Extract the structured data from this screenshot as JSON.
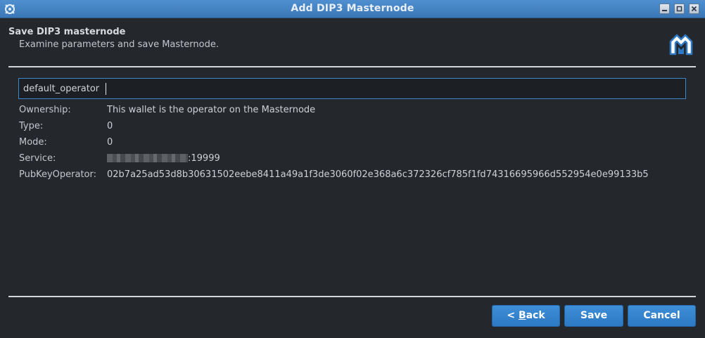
{
  "window": {
    "title": "Add DIP3 Masternode"
  },
  "header": {
    "title": "Save DIP3 masternode",
    "subtitle": "Examine parameters and save Masternode."
  },
  "form": {
    "name_value": "default_operator"
  },
  "details": {
    "ownership_label": "Ownership:",
    "ownership_value": "This wallet is the operator on the Masternode",
    "type_label": "Type:",
    "type_value": "0",
    "mode_label": "Mode:",
    "mode_value": "0",
    "service_label": "Service:",
    "service_port": ":19999",
    "pubkey_label": "PubKeyOperator:",
    "pubkey_value": "02b7a25ad53d8b30631502eebe8411a49a1f3de3060f02e368a6c372326cf785f1fd74316695966d552954e0e99133b5"
  },
  "buttons": {
    "back_prefix": "< ",
    "back_mnemonic": "B",
    "back_rest": "ack",
    "save": "Save",
    "cancel": "Cancel"
  },
  "colors": {
    "titlebar": "#3b77b6",
    "background": "#24282d",
    "button": "#3585cf",
    "input_border": "#3d86c9"
  },
  "icons": [
    "app-icon",
    "minimize-icon",
    "maximize-icon",
    "close-icon",
    "dash-logo-icon"
  ]
}
